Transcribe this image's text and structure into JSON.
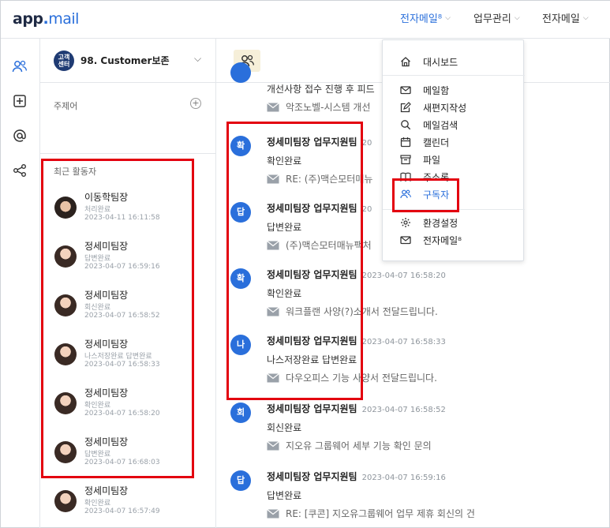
{
  "header": {
    "logo_app": "app",
    "logo_dot": ".",
    "logo_mail": "mail",
    "nav": [
      {
        "label": "전자메일⁸",
        "active": true
      },
      {
        "label": "업무관리",
        "active": false
      },
      {
        "label": "전자메일",
        "active": false
      }
    ]
  },
  "sidebar": {
    "team_badge": "고객\n센터",
    "team_name": "98. Customer보존",
    "topic_label": "주제어",
    "recent_label": "최근 활동자",
    "activities": [
      {
        "name": "이동학팀장",
        "status": "처리완료",
        "time": "2023-04-11 16:11:58",
        "avatar": "male"
      },
      {
        "name": "정세미팀장",
        "status": "답변완료",
        "time": "2023-04-07 16:59:16",
        "avatar": "female"
      },
      {
        "name": "정세미팀장",
        "status": "회신완료",
        "time": "2023-04-07 16:58:52",
        "avatar": "female"
      },
      {
        "name": "정세미팀장",
        "status": "나스저장완료 답변완료",
        "time": "2023-04-07 16:58:33",
        "avatar": "female"
      },
      {
        "name": "정세미팀장",
        "status": "확인완료",
        "time": "2023-04-07 16:58:20",
        "avatar": "female"
      },
      {
        "name": "정세미팀장",
        "status": "답변완료",
        "time": "2023-04-07 16:68:03",
        "avatar": "female"
      },
      {
        "name": "정세미팀장",
        "status": "확인완료",
        "time": "2023-04-07 16:57:49",
        "avatar": "female"
      }
    ]
  },
  "feed": {
    "partial_top": {
      "action": "개선사항 접수 진행 후 피드",
      "mail": "악조노벨-시스템 개선"
    },
    "items": [
      {
        "badge": "확",
        "title": "정세미팀장 업무지원팀",
        "time": "20",
        "action": "확인완료",
        "mail": "RE: (주)맥슨모터매뉴"
      },
      {
        "badge": "답",
        "title": "정세미팀장 업무지원팀",
        "time": "20",
        "action": "답변완료",
        "mail": "(주)맥슨모터매뉴팩처"
      },
      {
        "badge": "확",
        "title": "정세미팀장 업무지원팀",
        "time": "2023-04-07 16:58:20",
        "action": "확인완료",
        "mail": "워크플랜 사양(?)소개서 전달드립니다."
      },
      {
        "badge": "나",
        "title": "정세미팀장 업무지원팀",
        "time": "2023-04-07 16:58:33",
        "action": "나스저장완료 답변완료",
        "mail": "다우오피스 기능 사양서 전달드립니다."
      },
      {
        "badge": "회",
        "title": "정세미팀장 업무지원팀",
        "time": "2023-04-07 16:58:52",
        "action": "회신완료",
        "mail": "지오유 그룹웨어 세부 기능 확인 문의"
      },
      {
        "badge": "답",
        "title": "정세미팀장 업무지원팀",
        "time": "2023-04-07 16:59:16",
        "action": "답변완료",
        "mail": "RE: [쿠콘] 지오유그룹웨어 업무 제휴 회신의 건"
      }
    ]
  },
  "dropdown": {
    "items": [
      {
        "label": "대시보드",
        "icon": "home-icon"
      },
      {
        "label": "메일함",
        "icon": "mail-icon"
      },
      {
        "label": "새편지작성",
        "icon": "compose-icon"
      },
      {
        "label": "메일검색",
        "icon": "search-icon"
      },
      {
        "label": "캘린더",
        "icon": "calendar-icon"
      },
      {
        "label": "파일",
        "icon": "file-box-icon"
      },
      {
        "label": "주소록",
        "icon": "address-book-icon"
      },
      {
        "label": "구독자",
        "icon": "subscribers-icon"
      },
      {
        "label": "환경설정",
        "icon": "gear-icon"
      },
      {
        "label": "전자메일⁸",
        "icon": "mail-icon"
      }
    ]
  },
  "colors": {
    "accent": "#2a6fdb",
    "highlight": "#e3000f",
    "badge": "#2a6fdb"
  }
}
